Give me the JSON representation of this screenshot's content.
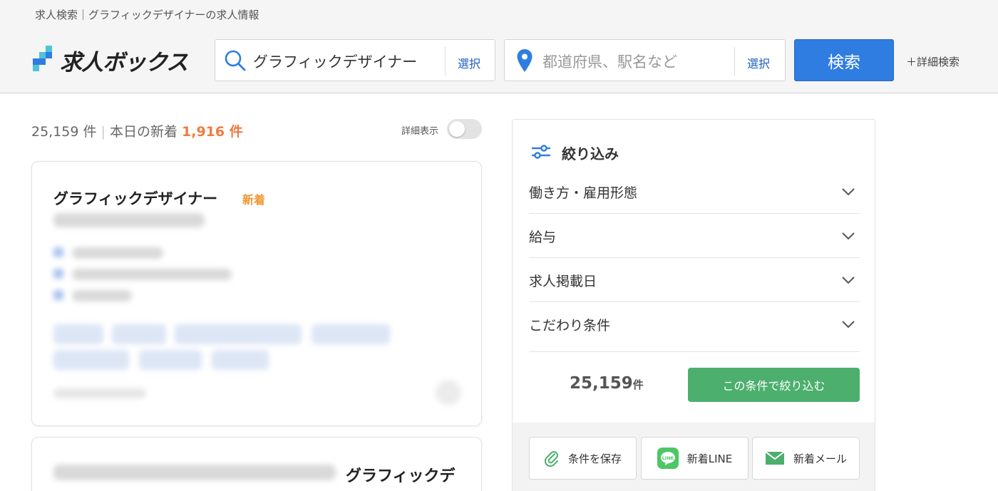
{
  "breadcrumb": "求人検索｜グラフィックデザイナーの求人情報",
  "logo": {
    "text": "求人ボックス"
  },
  "search": {
    "keyword_value": "グラフィックデザイナー",
    "keyword_select": "選択",
    "location_placeholder": "都道府県、駅名など",
    "location_select": "選択",
    "button": "検索",
    "advanced": "＋詳細検索"
  },
  "results": {
    "total": "25,159 件",
    "today_label": "本日の新着",
    "today_count": "1,916 件",
    "detail_toggle_label": "詳細表示",
    "detail_toggle_on": false
  },
  "jobs": [
    {
      "title": "グラフィックデザイナー",
      "badge": "新着"
    },
    {
      "title": "グラフィックデ"
    }
  ],
  "filter": {
    "title": "絞り込み",
    "items": [
      {
        "label": "働き方・雇用形態"
      },
      {
        "label": "給与"
      },
      {
        "label": "求人掲載日"
      },
      {
        "label": "こだわり条件"
      }
    ],
    "count": "25,159",
    "count_unit": "件",
    "apply": "この条件で絞り込む",
    "save": "条件を保存",
    "line": "新着LINE",
    "mail": "新着メール"
  },
  "colors": {
    "primary": "#2f7de1",
    "accent_orange": "#f07b3f",
    "new_badge": "#f0962f",
    "apply_green": "#4caf6e",
    "line_green": "#4cc764"
  }
}
